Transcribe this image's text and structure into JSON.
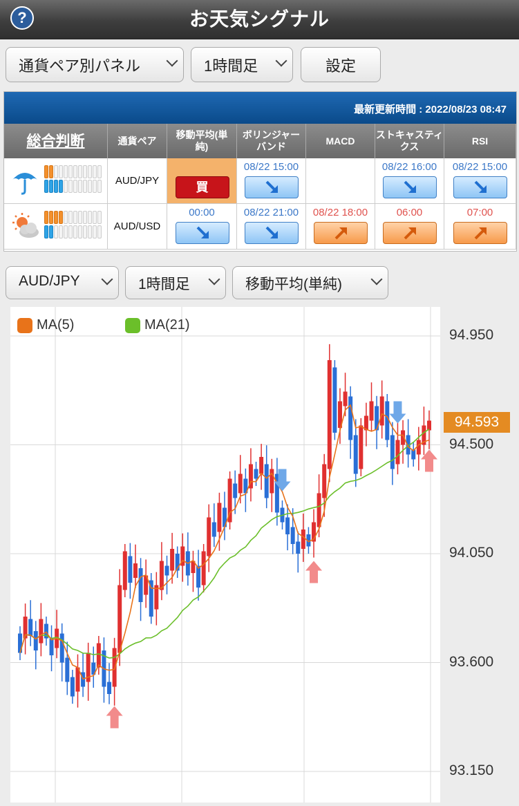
{
  "header": {
    "title": "お天気シグナル",
    "help_label": "?"
  },
  "toolbar": {
    "panel_select": "通貨ペア別パネル",
    "timeframe_select": "1時間足",
    "settings_label": "設定"
  },
  "panel": {
    "last_update": "最新更新時間 : 2022/08/23 08:47",
    "headers": [
      "総合判断",
      "通貨ペア",
      "移動平均(単\n純)",
      "ボリンジャー\nバンド",
      "MACD",
      "ストキャスティ\nクス",
      "RSI"
    ],
    "rows": [
      {
        "weather_icon": "umbrella-icon",
        "pair": "AUD/JPY",
        "strength": {
          "sell": 2,
          "buy": 4
        },
        "signals": [
          {
            "time": "",
            "type": "buy",
            "label": "買"
          },
          {
            "time": "08/22 15:00",
            "type": "down"
          },
          {
            "time": "",
            "type": "none"
          },
          {
            "time": "08/22 16:00",
            "type": "down"
          },
          {
            "time": "08/22 15:00",
            "type": "down"
          }
        ]
      },
      {
        "weather_icon": "sun-cloud-icon",
        "pair": "AUD/USD",
        "strength": {
          "sell": 4,
          "buy": 2
        },
        "signals": [
          {
            "time": "00:00",
            "type": "down"
          },
          {
            "time": "08/22 21:00",
            "type": "down"
          },
          {
            "time": "08/22 18:00",
            "type": "up"
          },
          {
            "time": "06:00",
            "type": "up"
          },
          {
            "time": "07:00",
            "type": "up"
          }
        ]
      }
    ]
  },
  "chart_controls": {
    "pair_select": "AUD/JPY",
    "timeframe_select": "1時間足",
    "indicator_select": "移動平均(単純)"
  },
  "chart_data": {
    "type": "candlestick",
    "legend": [
      "MA(5)",
      "MA(21)"
    ],
    "colors": {
      "up": "#e03030",
      "down": "#2a6fd6",
      "ma5": "#e8731a",
      "ma21": "#6bbf2a",
      "sig_up": "#f28b8b",
      "sig_down": "#6fa8e8"
    },
    "y_ticks": [
      "94.950",
      "94.500",
      "94.050",
      "93.600",
      "93.150"
    ],
    "ylim": [
      93.15,
      94.95
    ],
    "current_price": "94.593",
    "candles": [
      [
        93.72,
        93.64
      ],
      [
        93.7,
        93.79
      ],
      [
        93.78,
        93.71
      ],
      [
        93.73,
        93.65
      ],
      [
        93.68,
        93.78
      ],
      [
        93.76,
        93.7
      ],
      [
        93.7,
        93.63
      ],
      [
        93.66,
        93.74
      ],
      [
        93.72,
        93.6
      ],
      [
        93.62,
        93.52
      ],
      [
        93.54,
        93.46
      ],
      [
        93.48,
        93.58
      ],
      [
        93.56,
        93.5
      ],
      [
        93.52,
        93.64
      ],
      [
        93.6,
        93.55
      ],
      [
        93.58,
        93.68
      ],
      [
        93.65,
        93.5
      ],
      [
        93.52,
        93.47
      ],
      [
        93.5,
        93.66
      ],
      [
        93.64,
        93.92
      ],
      [
        93.9,
        94.06
      ],
      [
        94.04,
        93.93
      ],
      [
        93.95,
        94.01
      ],
      [
        93.99,
        93.85
      ],
      [
        93.88,
        93.96
      ],
      [
        93.94,
        93.79
      ],
      [
        93.82,
        93.92
      ],
      [
        93.9,
        94.02
      ],
      [
        94.0,
        93.96
      ],
      [
        93.98,
        94.07
      ],
      [
        94.05,
        93.98
      ],
      [
        94.0,
        94.08
      ],
      [
        94.06,
        93.96
      ],
      [
        93.97,
        94.02
      ],
      [
        94.0,
        93.91
      ],
      [
        93.92,
        94.06
      ],
      [
        94.04,
        94.2
      ],
      [
        94.18,
        94.12
      ],
      [
        94.14,
        94.26
      ],
      [
        94.24,
        94.16
      ],
      [
        94.18,
        94.36
      ],
      [
        94.34,
        94.28
      ],
      [
        94.3,
        94.38
      ],
      [
        94.36,
        94.3
      ],
      [
        94.32,
        94.42
      ],
      [
        94.4,
        94.36
      ],
      [
        94.38,
        94.45
      ],
      [
        94.42,
        94.28
      ],
      [
        94.3,
        94.4
      ],
      [
        94.38,
        94.22
      ],
      [
        94.24,
        94.18
      ],
      [
        94.2,
        94.13
      ],
      [
        94.16,
        94.09
      ],
      [
        94.1,
        94.05
      ],
      [
        94.07,
        94.15
      ],
      [
        94.13,
        94.08
      ],
      [
        94.1,
        94.18
      ],
      [
        94.16,
        94.3
      ],
      [
        94.28,
        94.42
      ],
      [
        94.4,
        94.85
      ],
      [
        94.82,
        94.55
      ],
      [
        94.57,
        94.68
      ],
      [
        94.66,
        94.72
      ],
      [
        94.7,
        94.52
      ],
      [
        94.54,
        94.38
      ],
      [
        94.4,
        94.58
      ],
      [
        94.56,
        94.62
      ],
      [
        94.6,
        94.68
      ],
      [
        94.66,
        94.56
      ],
      [
        94.58,
        94.7
      ],
      [
        94.68,
        94.52
      ],
      [
        94.54,
        94.4
      ],
      [
        94.42,
        94.52
      ],
      [
        94.5,
        94.56
      ],
      [
        94.54,
        94.46
      ],
      [
        94.48,
        94.44
      ],
      [
        94.46,
        94.52
      ],
      [
        94.5,
        94.58
      ],
      [
        94.56,
        94.6
      ]
    ],
    "signals": [
      {
        "type": "up",
        "index": 18
      },
      {
        "type": "down",
        "index": 50
      },
      {
        "type": "up",
        "index": 56
      },
      {
        "type": "down",
        "index": 72
      },
      {
        "type": "up",
        "index": 78
      }
    ]
  }
}
